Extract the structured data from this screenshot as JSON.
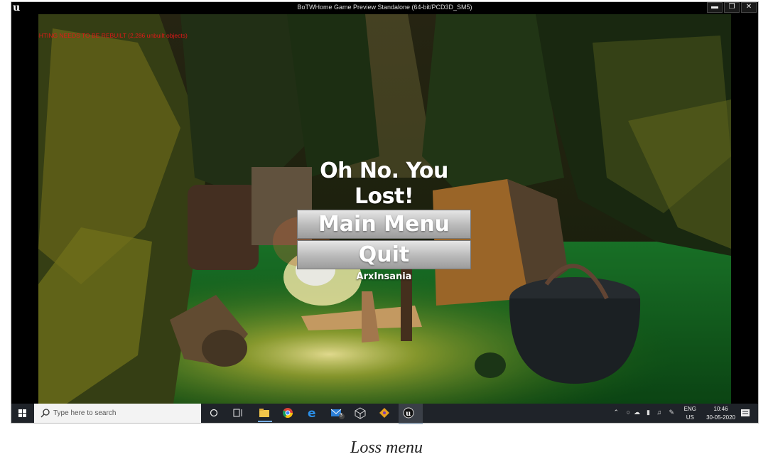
{
  "window": {
    "title": "BoTWHome Game Preview Standalone (64-bit/PCD3D_SM5)",
    "logo_glyph": "u",
    "minimize_glyph": "▬",
    "restore_glyph": "❐",
    "close_glyph": "✕"
  },
  "game": {
    "warning": "LIGHTING NEEDS TO BE REBUILT (2,286 unbuilt objects)",
    "loss_title": "Oh No. You Lost!",
    "main_menu_label": "Main Menu",
    "quit_label": "Quit",
    "credit": "ArxInsania"
  },
  "taskbar": {
    "search_placeholder": "Type here to search",
    "apps": [
      "cortana-icon",
      "task-view-icon",
      "file-explorer-icon",
      "chrome-icon",
      "edge-icon",
      "mail-icon",
      "3d-viewer-icon",
      "git-icon",
      "unreal-engine-icon"
    ],
    "mail_badge": "3",
    "language": "ENG",
    "region": "US",
    "time": "10:46",
    "date": "30-05-2020"
  },
  "caption": "Loss menu",
  "colors": {
    "warning": "#e01818",
    "taskbar": "#1f2329",
    "button_top": "#e6e6e6",
    "button_bottom": "#9c9c9c"
  }
}
